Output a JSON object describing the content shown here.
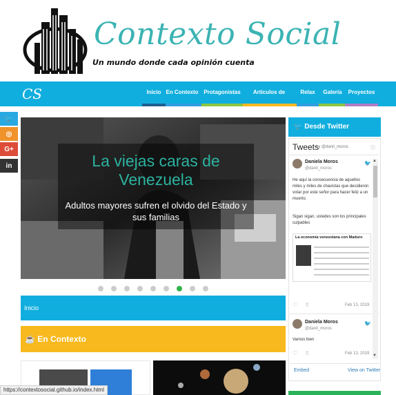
{
  "site": {
    "title": "Contexto Social",
    "tagline": "Un mundo donde cada opinión cuenta",
    "brand_short": "CS"
  },
  "nav": {
    "items": [
      {
        "label": "Inicio",
        "bar": "#1d5f8f"
      },
      {
        "label": "En Contexto",
        "bar": "#2f9de0"
      },
      {
        "label": "Protagonistas",
        "bar": "#8cc63f"
      },
      {
        "label": "Artículos de opinión",
        "bar": "#f7b91d"
      },
      {
        "label": "Relax",
        "bar": "#2f9de0"
      },
      {
        "label": "Galería",
        "bar": "#8cc63f"
      },
      {
        "label": "Proyectos",
        "bar": "#b07cc6"
      }
    ]
  },
  "social": [
    {
      "icon": "twitter-icon",
      "glyph": "🐦",
      "color": "#29a9e1"
    },
    {
      "icon": "instagram-icon",
      "glyph": "◎",
      "color": "#f0932b"
    },
    {
      "icon": "google-plus-icon",
      "glyph": "G+",
      "color": "#dd4b39"
    },
    {
      "icon": "linkedin-icon",
      "glyph": "in",
      "color": "#333333"
    }
  ],
  "slider": {
    "title": "La viejas caras de Venezuela",
    "subtitle": "Adultos mayores sufren el olvido del Estado y sus familias",
    "dots": 9,
    "active_dot": 7
  },
  "sections": {
    "inicio": "Inicio",
    "en_contexto": "En Contexto"
  },
  "twitter": {
    "header": "Desde Twitter",
    "widget_title": "Tweets",
    "by": "by @danil_moros",
    "tweets": [
      {
        "name": "Daniela Moros",
        "handle": "@danil_moros",
        "text": "He aquí la consecuencia de aquellos miles y miles de chavistas que decidieron votar por este señor para hacer feliz a un muerto.",
        "text2": "Sigan sigan, ustedes son los principales culpables",
        "card_title": "La economía venezolana con Maduro",
        "date": "Feb 13, 2019"
      },
      {
        "name": "Daniela Moros",
        "handle": "@danil_moros",
        "text": "Vamos bien",
        "date": "Feb 13, 2019"
      }
    ],
    "embed": "Embed",
    "view_on": "View on Twitter"
  },
  "status_url": "https://contextosocial.github.io/index.html"
}
